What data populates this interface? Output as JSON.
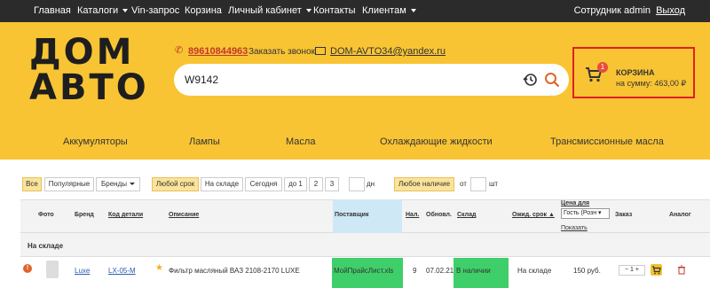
{
  "nav": {
    "items": [
      {
        "label": "Главная"
      },
      {
        "label": "Каталоги"
      },
      {
        "label": "Vin-запрос"
      },
      {
        "label": "Корзина"
      },
      {
        "label": "Личный кабинет"
      },
      {
        "label": "Контакты"
      },
      {
        "label": "Клиентам"
      }
    ],
    "user_label": "Сотрудник admin",
    "logout_label": "Выход"
  },
  "logo": {
    "line1": "ДОМ",
    "line2": "АВТО"
  },
  "contact": {
    "phone": "89610844963",
    "callback_label": "Заказать звонок",
    "email": "DOM-AVTO34@yandex.ru"
  },
  "search": {
    "value": "W9142"
  },
  "cart": {
    "badge": "1",
    "title": "КОРЗИНА",
    "sum": "на сумму: 463,00 ₽"
  },
  "categories": [
    "Аккумуляторы",
    "Лампы",
    "Масла",
    "Охлаждающие жидкости",
    "Трансмиссионные масла"
  ],
  "filters": {
    "type": [
      "Все",
      "Популярные",
      "Бренды"
    ],
    "term": [
      "Любой срок",
      "На складе",
      "Сегодня",
      "до 1",
      "2",
      "3"
    ],
    "term_unit": "дн",
    "stock": [
      "Любое наличие",
      "от"
    ],
    "stock_unit": "шт"
  },
  "table": {
    "headers": {
      "photo": "Фото",
      "brand": "Бренд",
      "code": "Код детали",
      "desc": "Описание",
      "supplier": "Поставщик",
      "avail": "Нал.",
      "updated": "Обновл.",
      "warehouse": "Склад",
      "wait": "Ожид. срок",
      "price_for": "Цена для",
      "price_select": "Гость (Розн",
      "show": "Показать",
      "order": "Заказ",
      "analog": "Аналог"
    },
    "section": "На складе",
    "rows": [
      {
        "brand": "Luxe",
        "code": "LX-05-M",
        "desc": "Фильтр масляный ВАЗ 2108-2170 LUXE",
        "supplier": "МойПрайсЛист.xls",
        "avail": "9",
        "updated": "07.02.21",
        "warehouse": "В наличии",
        "wait": "На складе",
        "price": "150 руб.",
        "qty": "1"
      }
    ]
  },
  "colors": {
    "accent": "#f9c433",
    "nav": "#2b2b2b",
    "green": "#3fcf6a",
    "supplier_col": "#cfe8f6",
    "cart_border": "#e02020"
  }
}
